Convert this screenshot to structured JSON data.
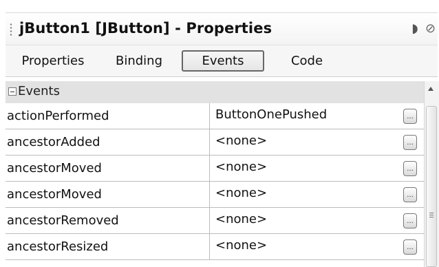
{
  "window": {
    "title": "jButton1 [JButton] - Properties",
    "minimize_icon": "◗",
    "close_icon": "⊘"
  },
  "tabs": [
    {
      "label": "Properties",
      "active": false
    },
    {
      "label": "Binding",
      "active": false
    },
    {
      "label": "Events",
      "active": true
    },
    {
      "label": "Code",
      "active": false
    }
  ],
  "category": {
    "label": "Events",
    "expanded": true
  },
  "rows": [
    {
      "name": "actionPerformed",
      "value": "ButtonOnePushed",
      "button": "..."
    },
    {
      "name": "ancestorAdded",
      "value": "<none>",
      "button": "..."
    },
    {
      "name": "ancestorMoved",
      "value": "<none>",
      "button": "..."
    },
    {
      "name": "ancestorMoved",
      "value": "<none>",
      "button": "..."
    },
    {
      "name": "ancestorRemoved",
      "value": "<none>",
      "button": "..."
    },
    {
      "name": "ancestorResized",
      "value": "<none>",
      "button": "..."
    }
  ],
  "colors": {
    "category_bg": "#e2e2e2",
    "grid_line": "#bcbcbc",
    "tab_border": "#666666"
  }
}
